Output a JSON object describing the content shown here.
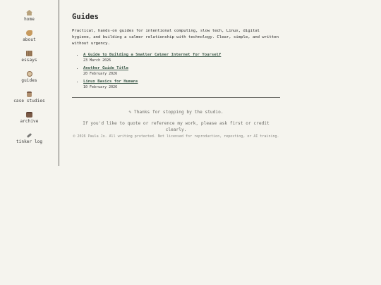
{
  "sidebar": {
    "items": [
      {
        "label": "home",
        "icon": "house-icon",
        "color": "#b8a27c"
      },
      {
        "label": "about",
        "icon": "hand-icon",
        "color": "#c79a5e"
      },
      {
        "label": "essays",
        "icon": "books-icon",
        "color": "#8a6a4c"
      },
      {
        "label": "guides",
        "icon": "compass-icon",
        "color": "#a8825a"
      },
      {
        "label": "case studies",
        "icon": "case-icon",
        "color": "#9a7e62"
      },
      {
        "label": "archive",
        "icon": "box-icon",
        "color": "#7a5a46"
      },
      {
        "label": "tinker log",
        "icon": "wrench-icon",
        "color": "#7a7a78"
      }
    ]
  },
  "main": {
    "title": "Guides",
    "intro": "Practical, hands-on guides for intentional computing, slow tech, Linux, digital hygiene, and building a calmer relationship with technology. Clear, simple, and written without urgency.",
    "guides": [
      {
        "title": "A Guide to Building a Smaller Calmer Internet for Yourself",
        "date": "23 March 2026"
      },
      {
        "title": "Another Guide Title",
        "date": "20 February 2026"
      },
      {
        "title": "Linux Basics for Humans",
        "date": "10 February 2026"
      }
    ]
  },
  "footer": {
    "thanks": "✎ Thanks for stopping by the studio.",
    "quote_note": "If you'd like to quote or reference my work, please ask first or credit clearly.",
    "copyright": "© 2026 Paula Jo. All writing protected. Not licensed for reproduction, reposting, or AI training."
  }
}
